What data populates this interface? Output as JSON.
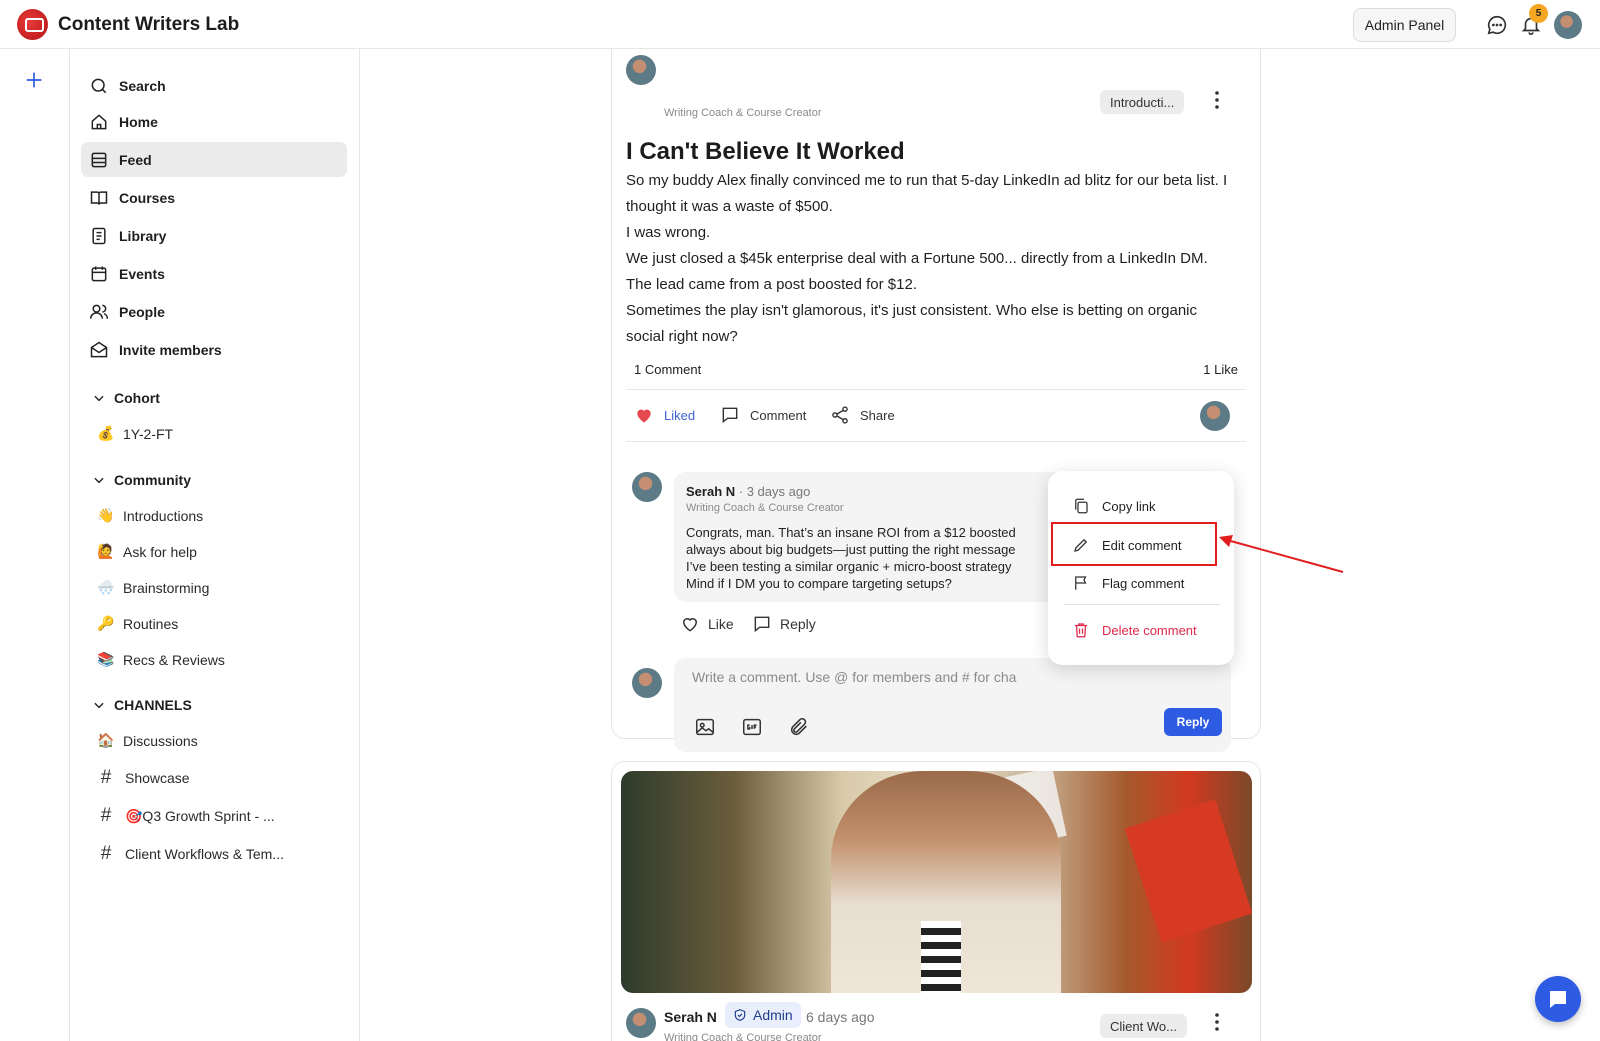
{
  "app": {
    "title": "Content Writers Lab",
    "admin_panel_label": "Admin Panel",
    "notification_count": "5"
  },
  "nav": [
    {
      "label": "Search",
      "icon": "search-icon"
    },
    {
      "label": "Home",
      "icon": "home-icon"
    },
    {
      "label": "Feed",
      "icon": "feed-icon",
      "active": true
    },
    {
      "label": "Courses",
      "icon": "book-icon"
    },
    {
      "label": "Library",
      "icon": "library-icon"
    },
    {
      "label": "Events",
      "icon": "calendar-icon"
    },
    {
      "label": "People",
      "icon": "people-icon"
    },
    {
      "label": "Invite members",
      "icon": "mail-icon"
    }
  ],
  "sections": {
    "cohort": {
      "label": "Cohort",
      "items": [
        {
          "emoji": "💰",
          "label": "1Y-2-FT"
        }
      ]
    },
    "community": {
      "label": "Community",
      "items": [
        {
          "emoji": "👋",
          "label": "Introductions"
        },
        {
          "emoji": "🙋",
          "label": "Ask for help"
        },
        {
          "emoji": "🌨️",
          "label": "Brainstorming"
        },
        {
          "emoji": "🔑",
          "label": "Routines"
        },
        {
          "emoji": "📚",
          "label": "Recs & Reviews"
        }
      ]
    },
    "channels": {
      "label": "CHANNELS",
      "items": [
        {
          "prefix": "🏠",
          "label": "Discussions"
        },
        {
          "prefix": "#",
          "label": "Showcase"
        },
        {
          "prefix": "#",
          "label": "🎯Q3 Growth Sprint - ..."
        },
        {
          "prefix": "#",
          "label": "Client Workflows & Tem..."
        }
      ]
    }
  },
  "post1": {
    "author_role": "Writing Coach & Course Creator",
    "tag": "Introducti...",
    "title": "I Can't Believe It Worked",
    "body": [
      "So my buddy Alex finally convinced me to run that 5-day LinkedIn ad blitz for our beta list. I thought it was a waste of $500.",
      "I was wrong.",
      "We just closed a $45k enterprise deal with a Fortune 500... directly from a LinkedIn DM. The lead came from a post boosted for $12.",
      "Sometimes the play isn't glamorous, it's just consistent. Who else is betting on organic social right now?"
    ],
    "comment_count": "1 Comment",
    "like_count": "1 Like",
    "actions": {
      "liked": "Liked",
      "comment": "Comment",
      "share": "Share"
    },
    "comment": {
      "author": "Serah N",
      "time": "3 days ago",
      "role": "Writing Coach & Course Creator",
      "lines": [
        "Congrats, man. That’s an insane ROI from a $12 boosted",
        "always about big budgets—just putting the right message",
        "I’ve been testing a similar organic + micro-boost strategy",
        "Mind if I DM you to compare targeting setups?"
      ],
      "like": "Like",
      "reply": "Reply"
    },
    "reply_placeholder": "Write a comment. Use @ for members and # for cha",
    "reply_button": "Reply"
  },
  "menu": {
    "copy_link": "Copy link",
    "edit_comment": "Edit comment",
    "flag_comment": "Flag comment",
    "delete_comment": "Delete comment"
  },
  "post2": {
    "author": "Serah N",
    "badge": "Admin",
    "time": "6 days ago",
    "tag": "Client Wo...",
    "author_role": "Writing Coach & Course Creator"
  },
  "colors": {
    "accent": "#2d5be3",
    "liked": "#3b63d6",
    "danger": "#e0284a",
    "highlight": "#e11d1d",
    "badge": "#f5a623"
  }
}
